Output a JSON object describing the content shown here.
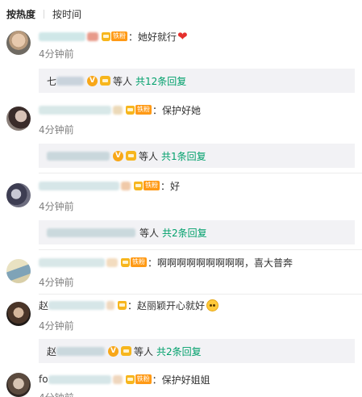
{
  "sort": {
    "hot_label": "按热度",
    "time_label": "按时间"
  },
  "badge_label": "铁粉",
  "etc_label": "等人",
  "comments": [
    {
      "name_prefix": "",
      "text": "：她好就行",
      "time": "4分钟前",
      "reply_prefix": "七",
      "reply_count": "共12条回复"
    },
    {
      "name_prefix": "",
      "text": "：保护好她",
      "time": "4分钟前",
      "reply_prefix": "",
      "reply_count": "共1条回复"
    },
    {
      "name_prefix": "",
      "text": "：好",
      "time": "4分钟前",
      "reply_prefix": "",
      "reply_count": "共2条回复"
    },
    {
      "name_prefix": "",
      "text": "：啊啊啊啊啊啊啊啊啊，喜大普奔",
      "time": "4分钟前",
      "reply_prefix": "",
      "reply_count": ""
    },
    {
      "name_prefix": "赵",
      "text": "：赵丽颖开心就好",
      "time": "4分钟前",
      "reply_prefix": "赵",
      "reply_count": "共2条回复"
    },
    {
      "name_prefix": "fo",
      "text": "：保护好姐姐",
      "time": "4分钟前",
      "reply_prefix": "",
      "reply_count": ""
    }
  ],
  "colors": {
    "reply_link": "#00a06b",
    "badge": "#ff9a16",
    "reply_bg": "#f2f2f5",
    "time": "#808080"
  }
}
